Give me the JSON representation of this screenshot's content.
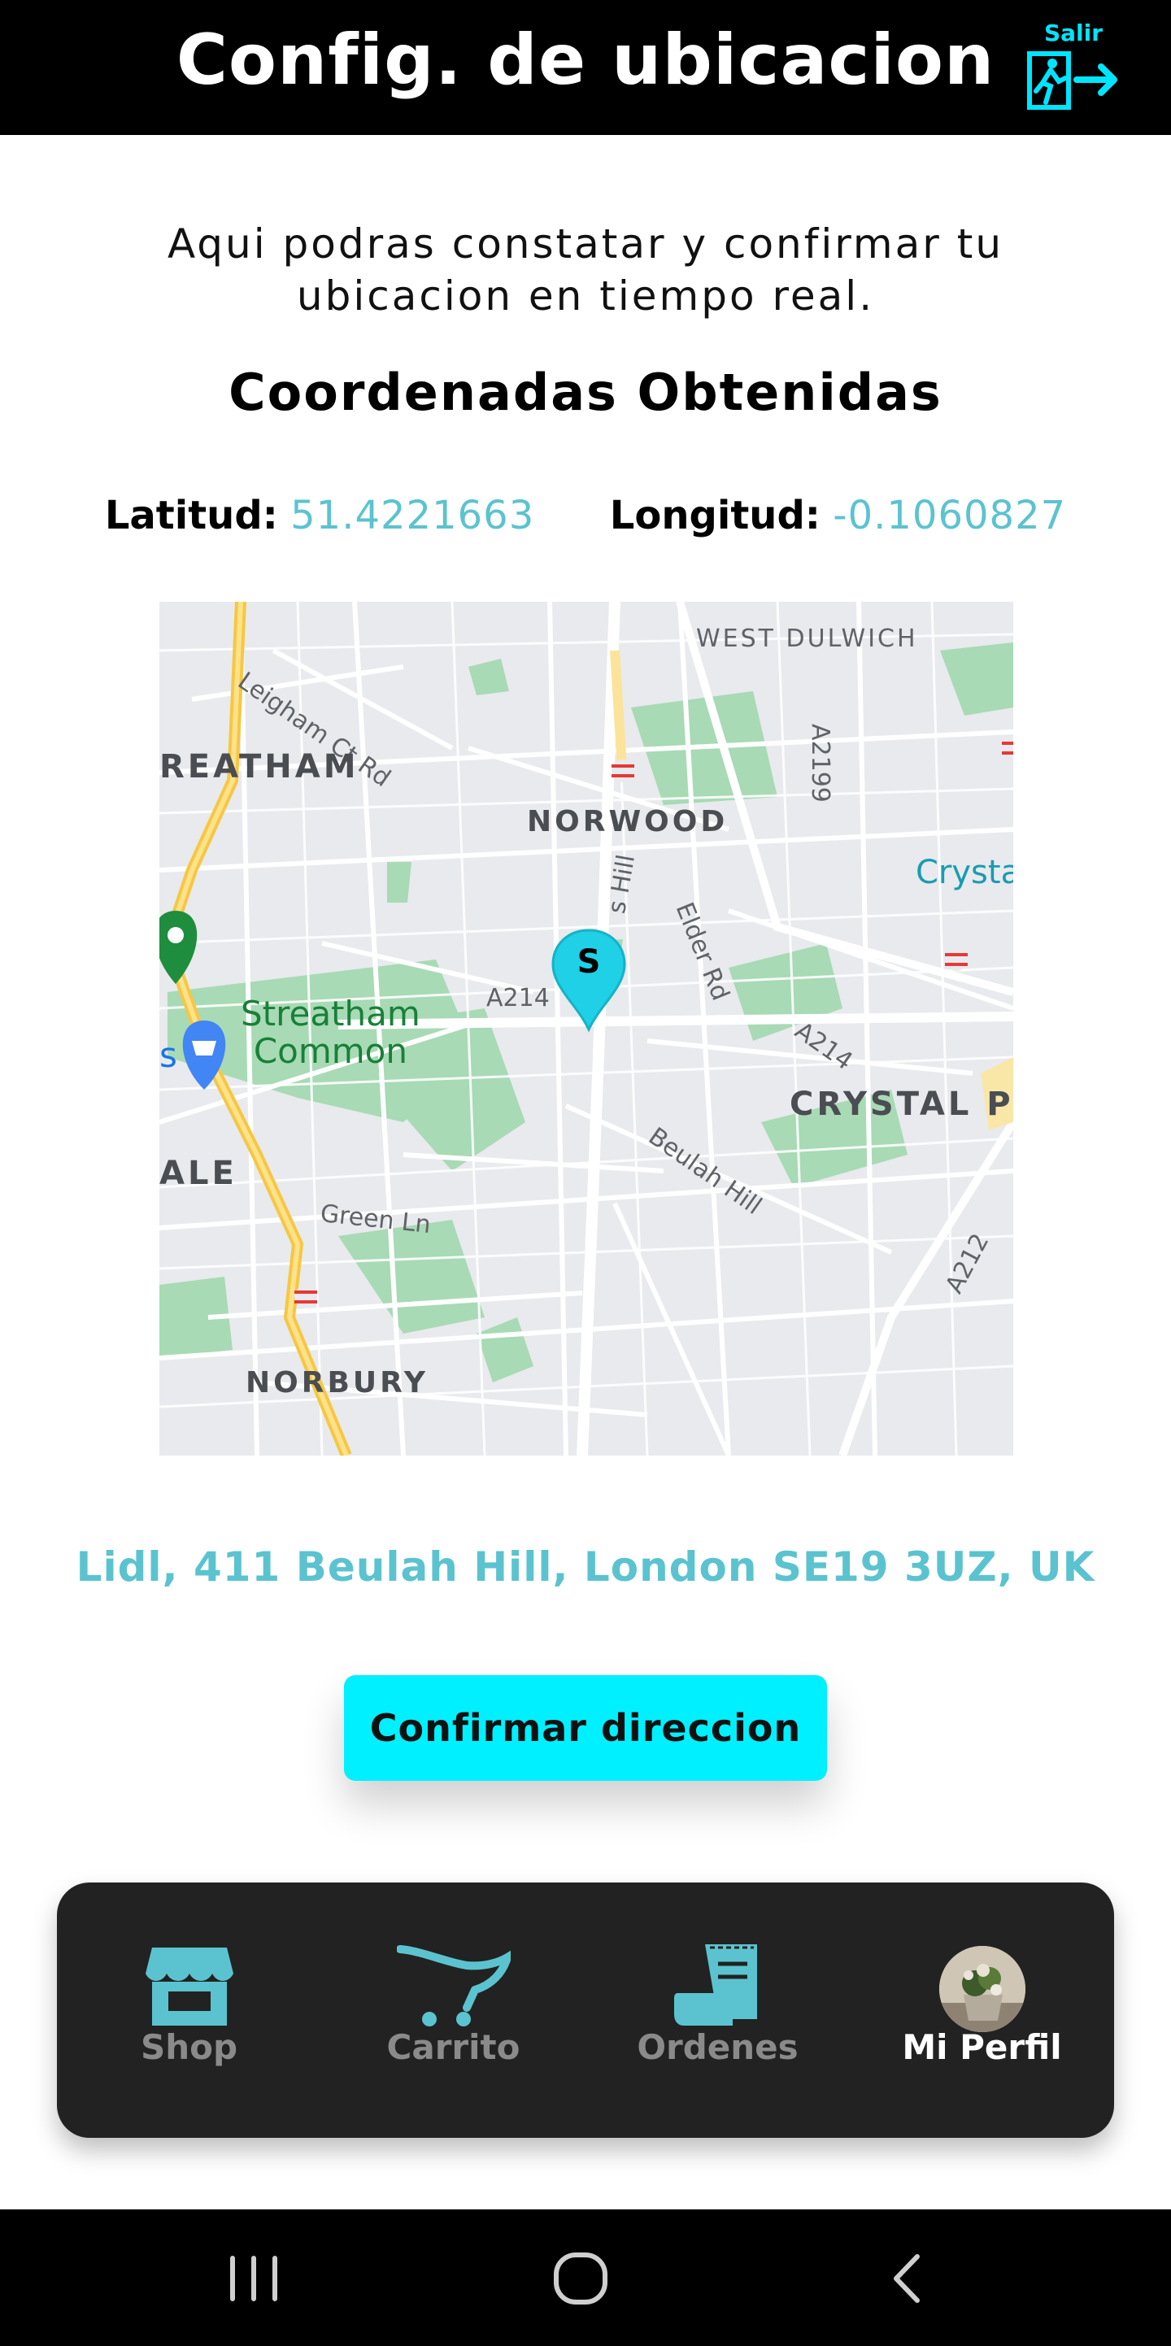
{
  "header": {
    "title": "Config. de ubicacion",
    "exit_label": "Salir",
    "exit_icon": "exit-door-icon"
  },
  "intro_text": "Aqui podras constatar y confirmar tu ubicacion en tiempo real.",
  "coords": {
    "heading": "Coordenadas Obtenidas",
    "lat_label": "Latitud:",
    "lat_value": "51.4221663",
    "lng_label": "Longitud:",
    "lng_value": "-0.1060827"
  },
  "map": {
    "labels": {
      "west_dulwich": "WEST DULWICH",
      "leigham": "Leigham Ct Rd",
      "streatham": "REATHAM",
      "norwood": "NORWOOD",
      "a2199": "A2199",
      "crystal_top": "Crysta",
      "hill": "s Hill",
      "elder": "Elder Rd",
      "a214_left": "A214",
      "a214_right": "A214",
      "streatham_common_1": "Streatham",
      "streatham_common_2": "Common",
      "s_letter": "s",
      "crystal_palace": "CRYSTAL P",
      "ale": "ALE",
      "beulah": "Beulah Hill",
      "green_ln": "Green Ln",
      "a212": "A212",
      "norbury": "NORBURY"
    },
    "marker_letter": "S",
    "colors": {
      "marker": "#1fd0e6",
      "park": "#a8dab5",
      "road_major": "#f6c744",
      "background": "#e8eaed"
    }
  },
  "address": "Lidl, 411 Beulah Hill, London SE19 3UZ, UK",
  "confirm_button": "Confirmar direccion",
  "nav": {
    "items": [
      {
        "label": "Shop",
        "icon": "shop-icon",
        "active": false
      },
      {
        "label": "Carrito",
        "icon": "cart-icon",
        "active": false
      },
      {
        "label": "Ordenes",
        "icon": "orders-icon",
        "active": false
      },
      {
        "label": "Mi Perfil",
        "icon": "avatar",
        "active": true
      }
    ],
    "icon_color": "#5bc3cf"
  },
  "system_bar": {
    "buttons": [
      "recents-icon",
      "home-icon",
      "back-icon"
    ]
  }
}
